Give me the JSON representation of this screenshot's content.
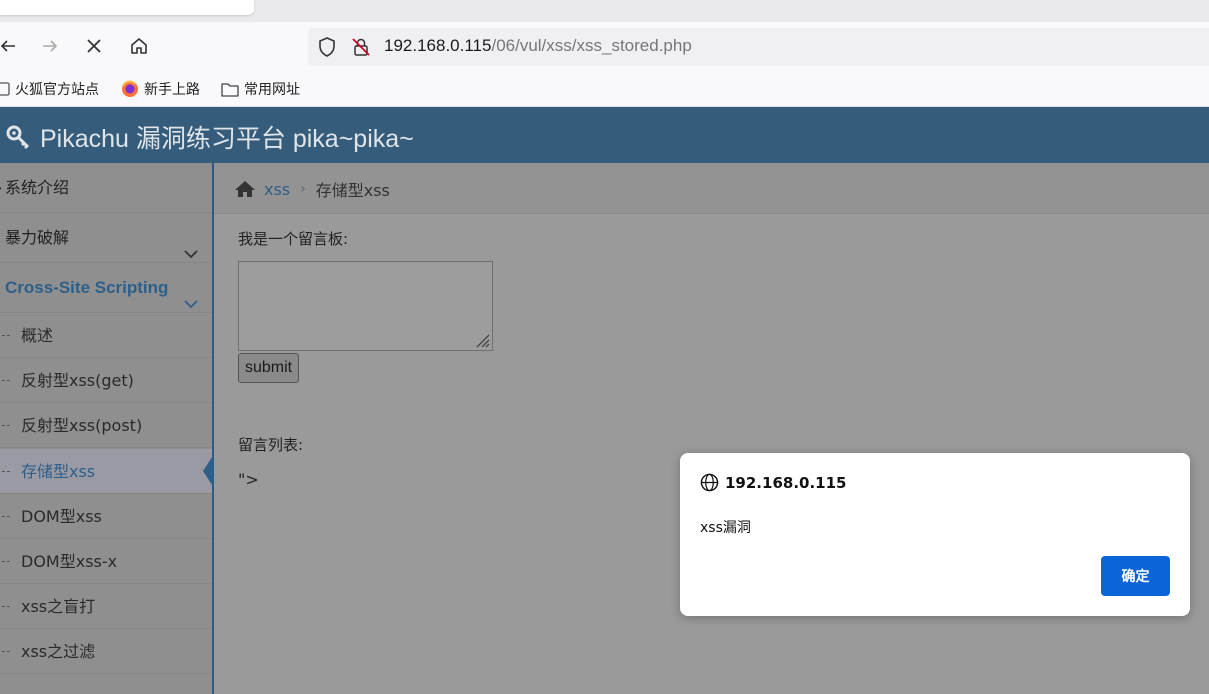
{
  "browser": {
    "url_host": "192.168.0.115",
    "url_path": "/06/vul/xss/xss_stored.php",
    "bookmarks": [
      "火狐官方站点",
      "新手上路",
      "常用网址"
    ]
  },
  "site": {
    "title": "Pikachu 漏洞练习平台 pika~pika~"
  },
  "sidebar": {
    "top_items": [
      "系统介绍",
      "暴力破解",
      "Cross-Site Scripting"
    ],
    "sub_items": [
      "概述",
      "反射型xss(get)",
      "反射型xss(post)",
      "存储型xss",
      "DOM型xss",
      "DOM型xss-x",
      "xss之盲打",
      "xss之过滤"
    ],
    "active_sub": "存储型xss"
  },
  "breadcrumb": {
    "link": "xss",
    "current": "存储型xss"
  },
  "main": {
    "board_label": "我是一个留言板:",
    "textarea_value": "",
    "submit_label": "submit",
    "list_label": "留言列表:",
    "message": "\">"
  },
  "alert": {
    "origin": "192.168.0.115",
    "message": "xss漏洞",
    "ok_label": "确定",
    "ok_color": "#0b64d8"
  },
  "colors": {
    "header_bg": "#355c7a",
    "accent": "#2d5f8b"
  }
}
